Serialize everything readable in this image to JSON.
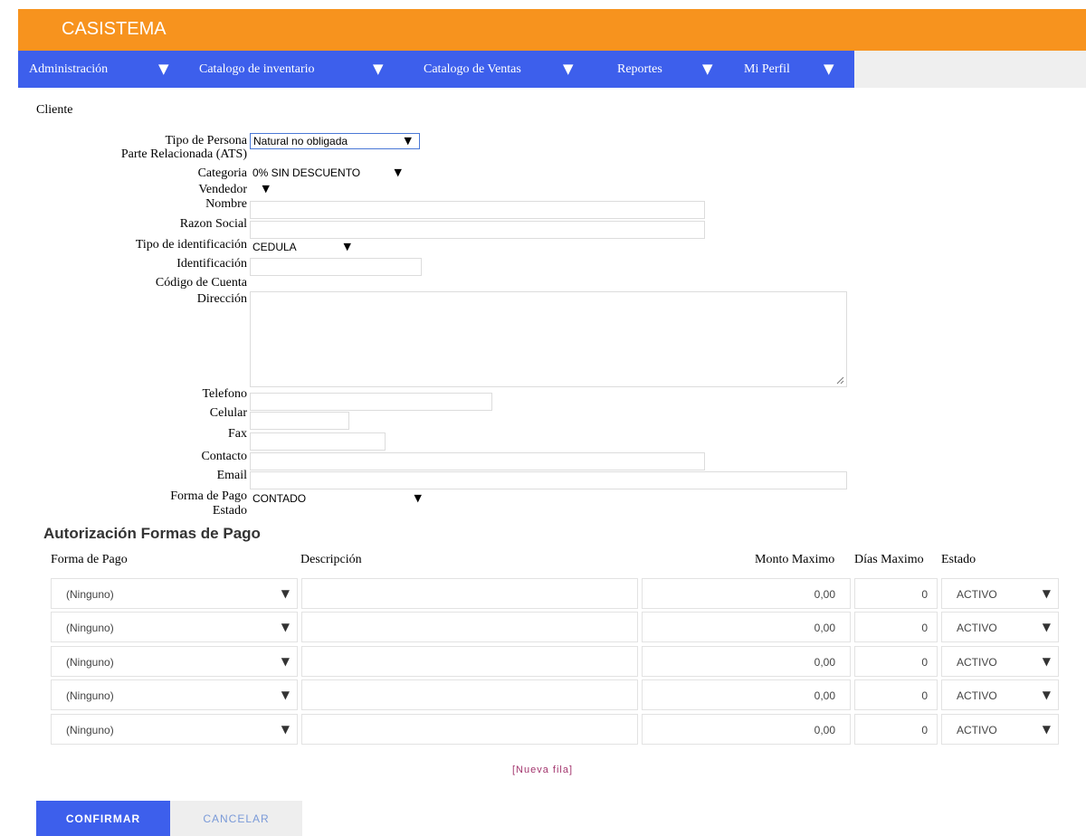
{
  "app": {
    "title": "CASISTEMA"
  },
  "nav": {
    "items": [
      {
        "label": "Administración",
        "caret": "▼"
      },
      {
        "label": "Catalogo de inventario",
        "caret": "▼"
      },
      {
        "label": "Catalogo de Ventas",
        "caret": "▼"
      },
      {
        "label": "Reportes",
        "caret": "▼"
      },
      {
        "label": "Mi Perfil",
        "caret": "▼"
      }
    ]
  },
  "page": {
    "title": "Cliente"
  },
  "form": {
    "tipo_persona": {
      "label": "Tipo de Persona",
      "value": "Natural no obligada"
    },
    "parte_relacionada": {
      "label": "Parte Relacionada (ATS)"
    },
    "categoria": {
      "label": "Categoria",
      "value": "0% SIN DESCUENTO"
    },
    "vendedor": {
      "label": "Vendedor",
      "value": ""
    },
    "nombre": {
      "label": "Nombre",
      "value": ""
    },
    "razon_social": {
      "label": "Razon Social",
      "value": ""
    },
    "tipo_identificacion": {
      "label": "Tipo de identificación",
      "value": "CEDULA"
    },
    "identificacion": {
      "label": "Identificación",
      "value": ""
    },
    "codigo_cuenta": {
      "label": "Código de Cuenta"
    },
    "direccion": {
      "label": "Dirección",
      "value": ""
    },
    "telefono": {
      "label": "Telefono",
      "value": ""
    },
    "celular": {
      "label": "Celular",
      "value": ""
    },
    "fax": {
      "label": "Fax",
      "value": ""
    },
    "contacto": {
      "label": "Contacto",
      "value": ""
    },
    "email": {
      "label": "Email",
      "value": ""
    },
    "forma_pago": {
      "label": "Forma de Pago",
      "value": "CONTADO"
    },
    "estado": {
      "label": "Estado"
    }
  },
  "caret": "▼",
  "auth": {
    "title": "Autorización Formas de Pago",
    "headers": {
      "forma_pago": "Forma de Pago",
      "descripcion": "Descripción",
      "monto_maximo": "Monto Maximo",
      "dias_maximo": "Días Maximo",
      "estado": "Estado"
    },
    "rows": [
      {
        "forma_pago": "(Ninguno)",
        "descripcion": "",
        "monto": "0,00",
        "dias": "0",
        "estado": "ACTIVO"
      },
      {
        "forma_pago": "(Ninguno)",
        "descripcion": "",
        "monto": "0,00",
        "dias": "0",
        "estado": "ACTIVO"
      },
      {
        "forma_pago": "(Ninguno)",
        "descripcion": "",
        "monto": "0,00",
        "dias": "0",
        "estado": "ACTIVO"
      },
      {
        "forma_pago": "(Ninguno)",
        "descripcion": "",
        "monto": "0,00",
        "dias": "0",
        "estado": "ACTIVO"
      },
      {
        "forma_pago": "(Ninguno)",
        "descripcion": "",
        "monto": "0,00",
        "dias": "0",
        "estado": "ACTIVO"
      }
    ],
    "new_row": "[Nueva fila]"
  },
  "buttons": {
    "confirm": "CONFIRMAR",
    "cancel": "CANCELAR"
  },
  "colors": {
    "header": "#f7931e",
    "nav": "#3d5fec",
    "link": "#a3366e"
  }
}
